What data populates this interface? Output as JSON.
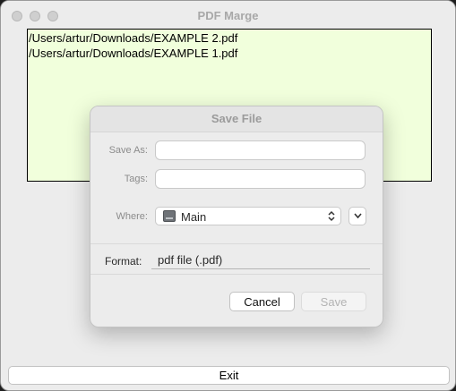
{
  "window": {
    "title": "PDF Marge"
  },
  "file_list": {
    "items": [
      "/Users/artur/Downloads/EXAMPLE 2.pdf",
      "/Users/artur/Downloads/EXAMPLE 1.pdf"
    ],
    "background_color": "#f1ffdc"
  },
  "exit_button": {
    "label": "Exit"
  },
  "save_dialog": {
    "title": "Save File",
    "save_as_label": "Save As:",
    "save_as_value": "",
    "tags_label": "Tags:",
    "tags_value": "",
    "where_label": "Where:",
    "where_value": "Main",
    "where_icon": "disk-icon",
    "format_label": "Format:",
    "format_value": "pdf file (.pdf)",
    "cancel_label": "Cancel",
    "save_label": "Save"
  }
}
